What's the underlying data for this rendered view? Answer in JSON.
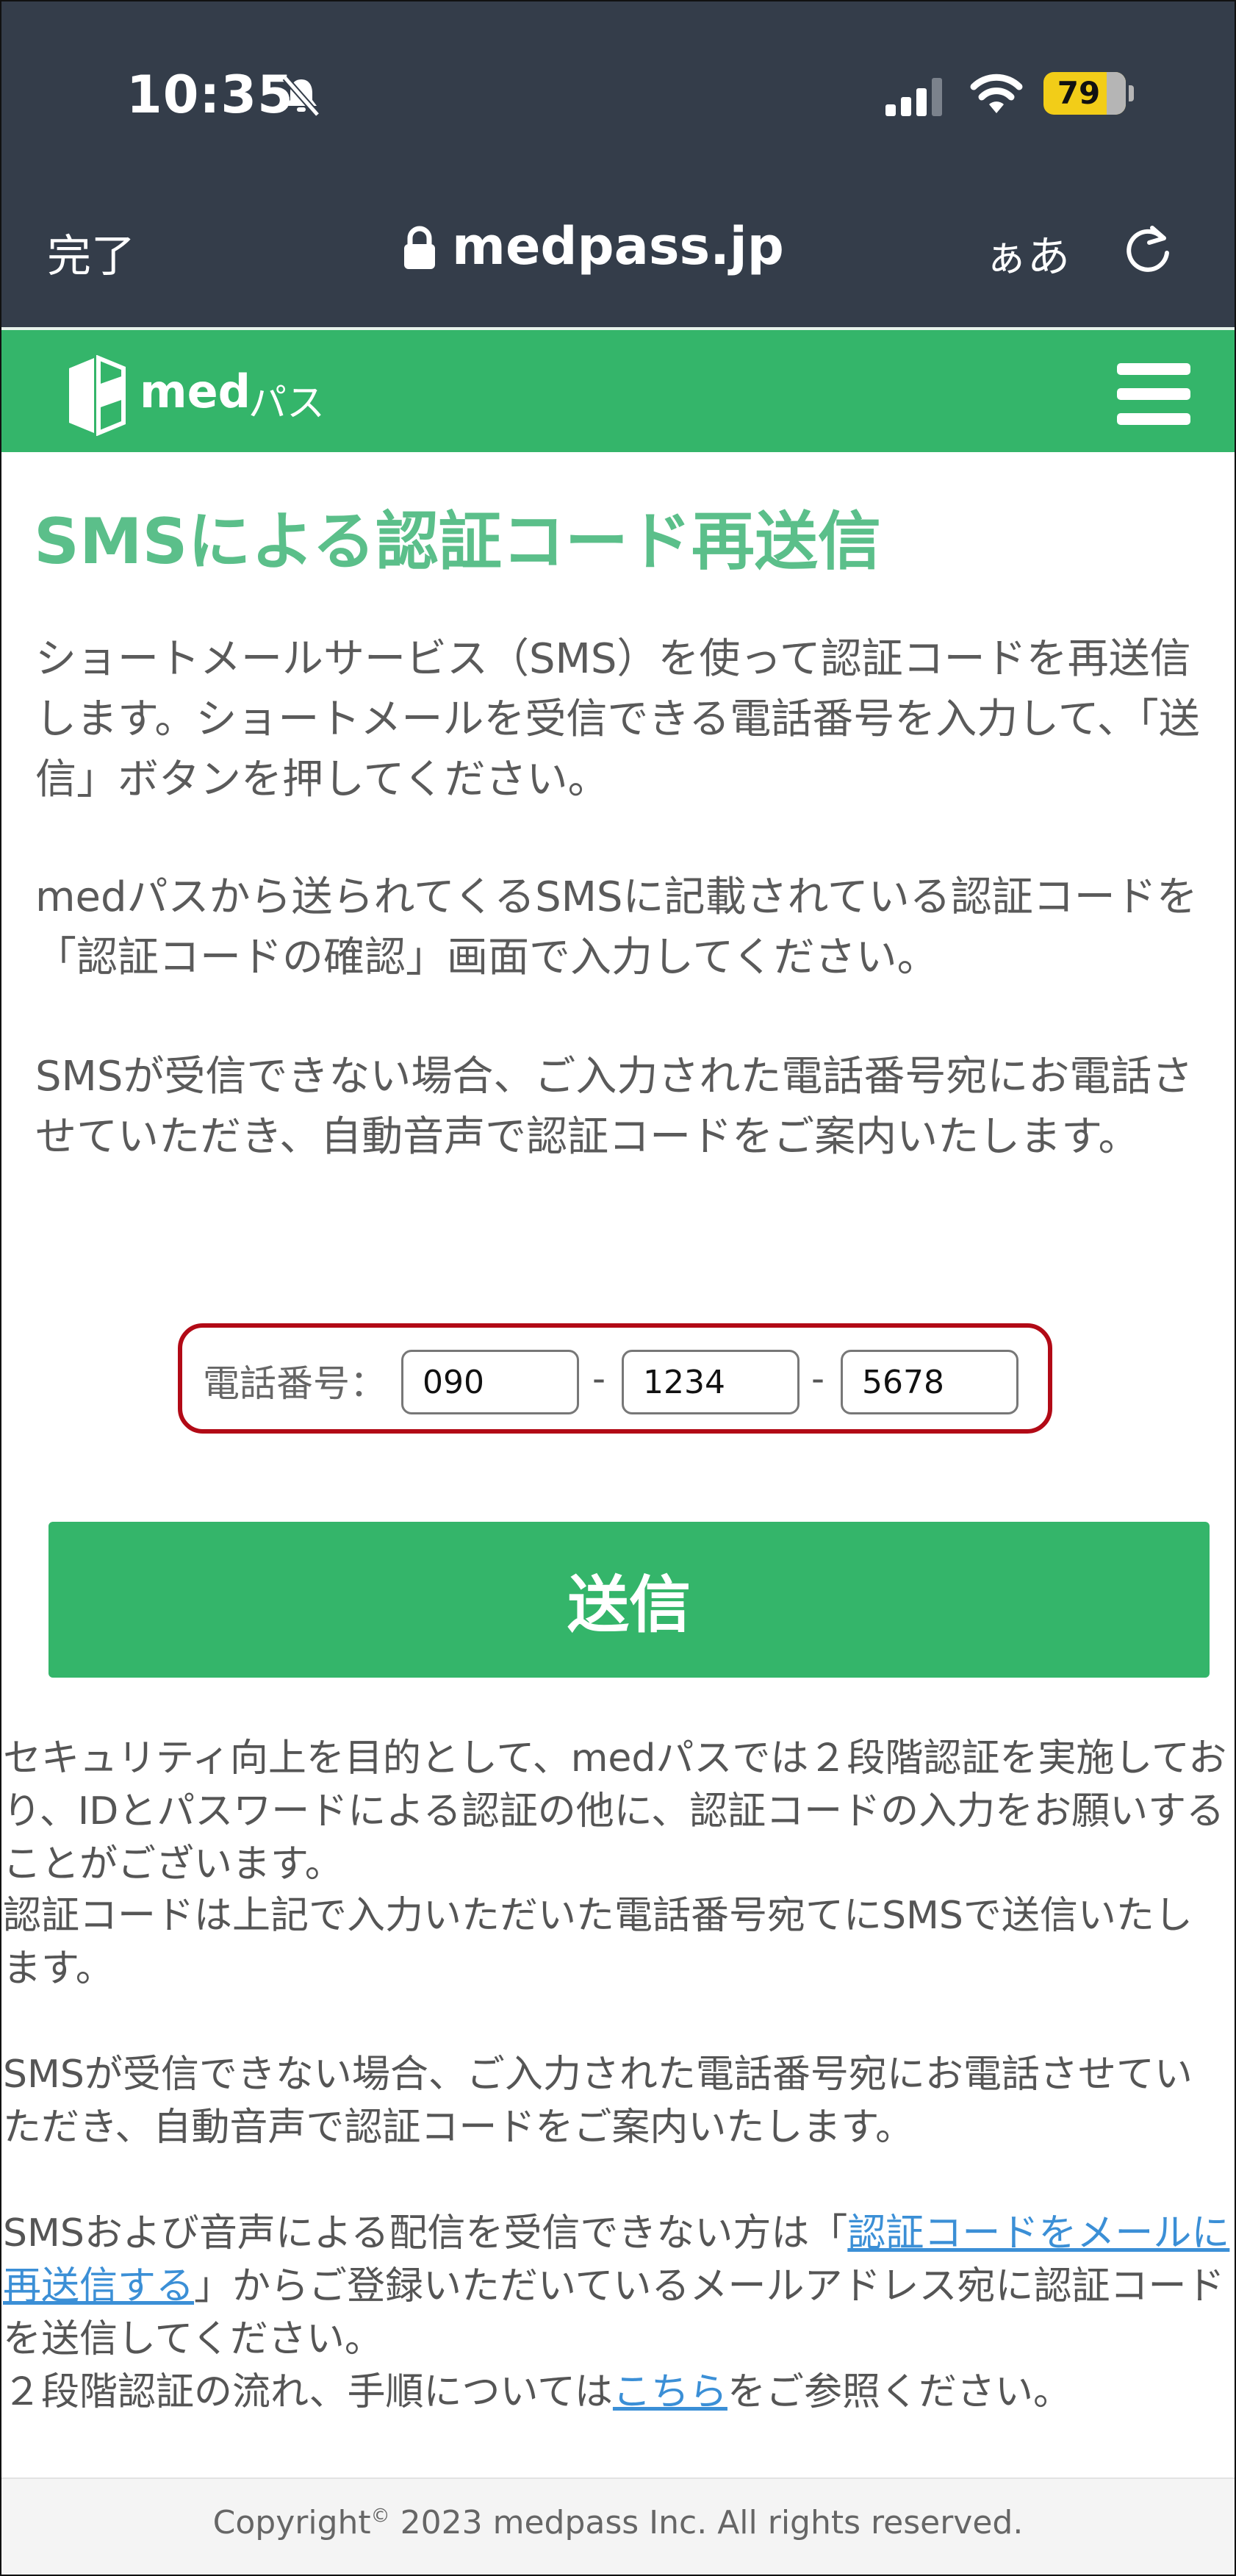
{
  "status_bar": {
    "time": "10:35",
    "battery": "79"
  },
  "browser": {
    "done_label": "完了",
    "url": "medpass.jp",
    "text_size_label": "ぁあ"
  },
  "header": {
    "logo_med": "med",
    "logo_pasu": "パス"
  },
  "page": {
    "title": "SMSによる認証コード再送信",
    "paragraph_1": "ショートメールサービス（SMS）を使って認証コードを再送信します。ショートメールを受信できる電話番号を入力して、「送信」ボタンを押してください。",
    "paragraph_2": "medパスから送られてくるSMSに記載されている認証コードを「認証コードの確認」画面で入力してください。",
    "paragraph_3": "SMSが受信できない場合、ご入力された電話番号宛にお電話させていただき、自動音声で認証コードをご案内いたします。"
  },
  "phone_form": {
    "label": "電話番号：",
    "part1": "090",
    "part2": "1234",
    "part3": "5678",
    "separator": "-",
    "submit_label": "送信"
  },
  "notes": {
    "note_1": "セキュリティ向上を目的として、medパスでは２段階認証を実施しており、IDとパスワードによる認証の他に、認証コードの入力をお願いすることがございます。",
    "note_2": "認証コードは上記で入力いただいた電話番号宛てにSMSで送信いたします。",
    "note_3": "SMSが受信できない場合、ご入力された電話番号宛にお電話させていただき、自動音声で認証コードをご案内いたします。",
    "note_4_prefix": "SMSおよび音声による配信を受信できない方は「",
    "note_4_link": "認証コードをメールに再送信する",
    "note_4_suffix": "」からご登録いただいているメールアドレス宛に認証コードを送信してください。",
    "note_5_prefix": "２段階認証の流れ、手順については",
    "note_5_link": "こちら",
    "note_5_suffix": "をご参照ください。"
  },
  "footer": {
    "copyright_prefix": "Copyright",
    "copyright_symbol": "©",
    "copyright_text": " 2023 medpass Inc. All rights reserved."
  },
  "colors": {
    "brand_green": "#34b56a",
    "title_green": "#5bbf8a",
    "highlight_red": "#b20a16",
    "browser_bar": "#343d4a"
  }
}
